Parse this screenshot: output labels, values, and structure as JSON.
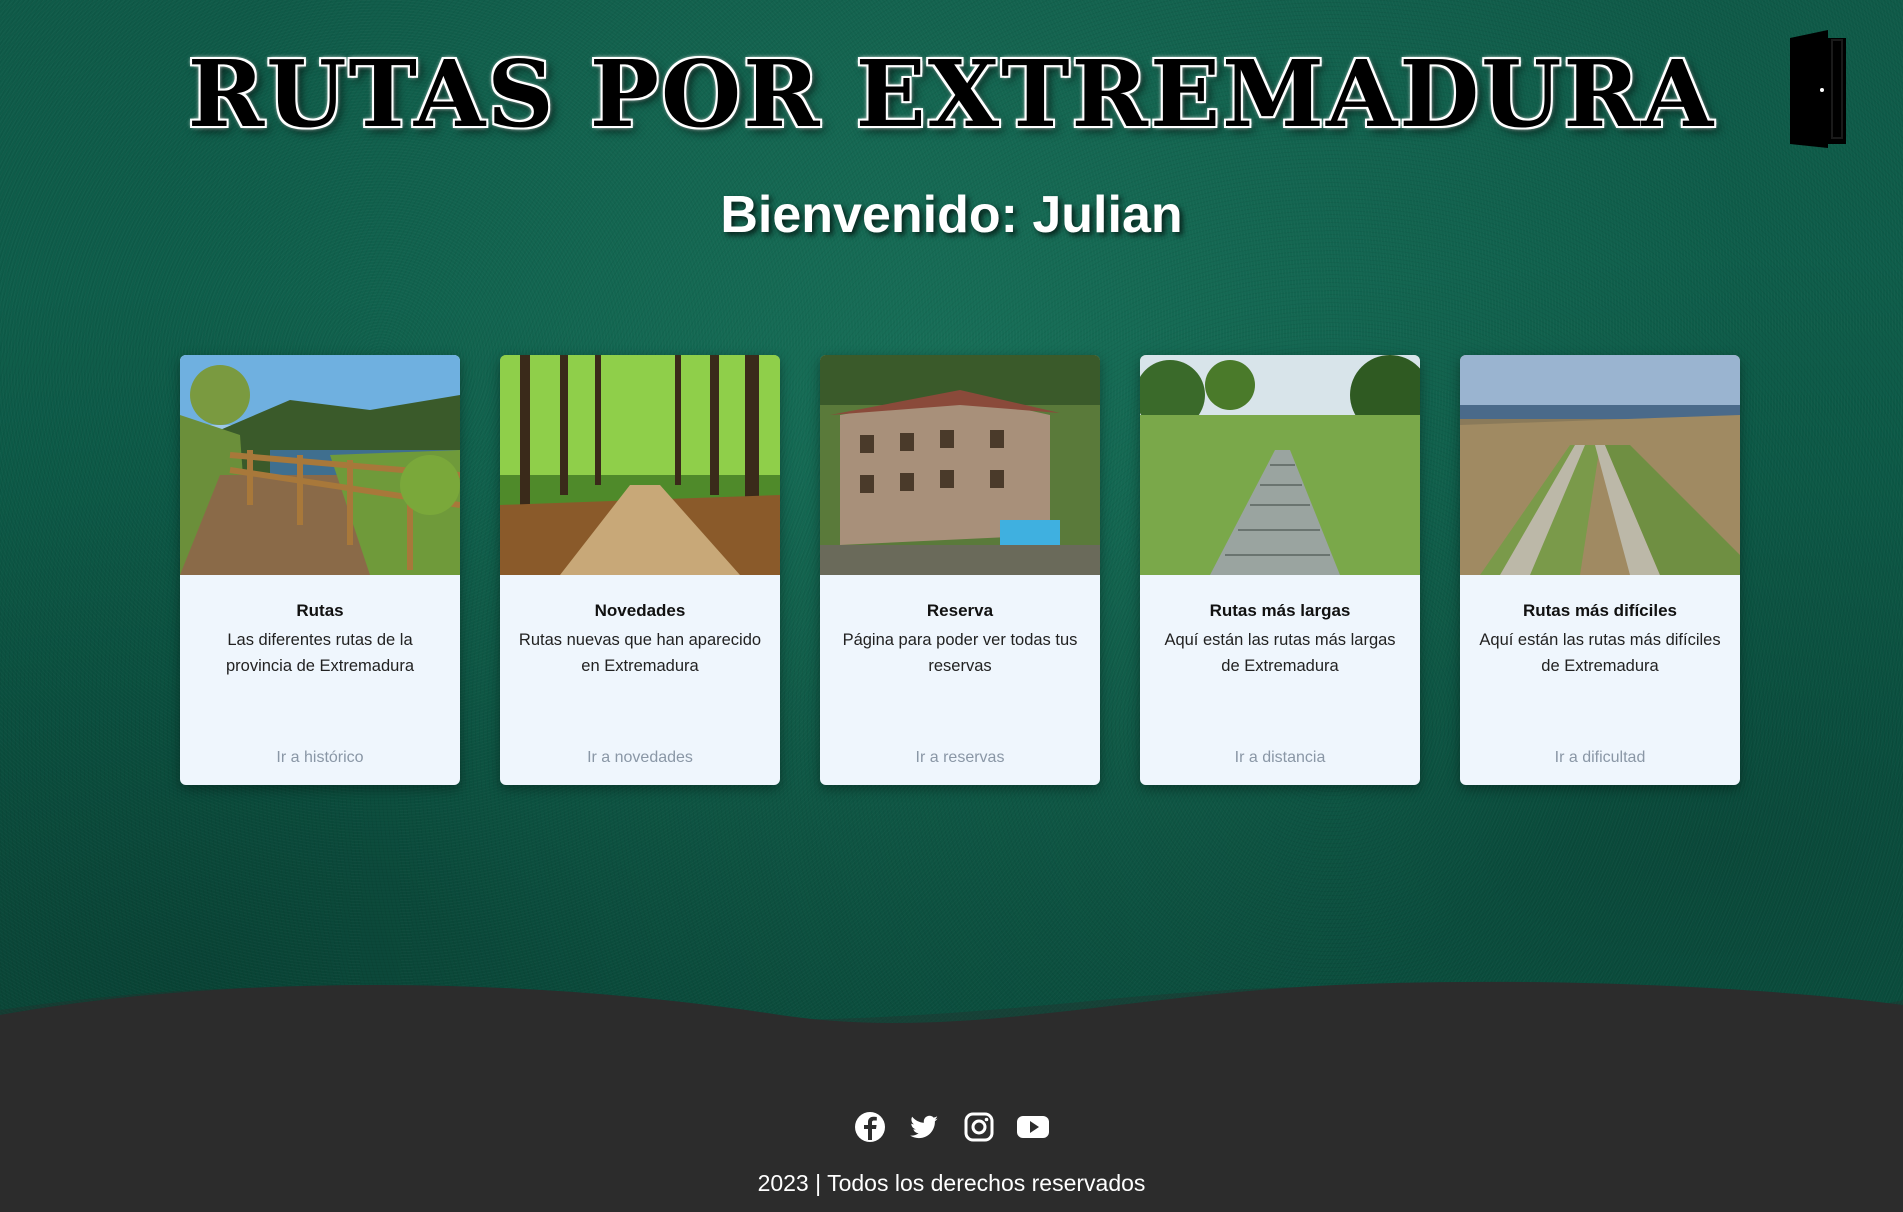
{
  "header": {
    "title": "RUTAS POR EXTREMADURA",
    "logout_icon": "door-icon"
  },
  "welcome": {
    "text": "Bienvenido: Julian"
  },
  "cards": [
    {
      "image": "lakeside-trail-photo",
      "title": "Rutas",
      "text": "Las diferentes rutas de la provincia de Extremadura",
      "link": "Ir a histórico"
    },
    {
      "image": "forest-path-photo",
      "title": "Novedades",
      "text": "Rutas nuevas que han aparecido en Extremadura",
      "link": "Ir a novedades"
    },
    {
      "image": "rural-hotel-photo",
      "title": "Reserva",
      "text": "Página para poder ver todas tus reservas",
      "link": "Ir a reservas"
    },
    {
      "image": "boardwalk-meadow-photo",
      "title": "Rutas más largas",
      "text": "Aquí están las rutas más largas de Extremadura",
      "link": "Ir a distancia"
    },
    {
      "image": "dirt-track-field-photo",
      "title": "Rutas más difíciles",
      "text": "Aquí están las rutas más difíciles de Extremadura",
      "link": "Ir a dificultad"
    }
  ],
  "footer": {
    "social": [
      "facebook-icon",
      "twitter-icon",
      "instagram-icon",
      "youtube-icon"
    ],
    "copyright": "2023 | Todos los derechos reservados"
  },
  "colors": {
    "background": "#0d5f4b",
    "card_background": "#eff6fd",
    "footer_background": "#2c2c2c",
    "link_color": "#8a97a6"
  }
}
